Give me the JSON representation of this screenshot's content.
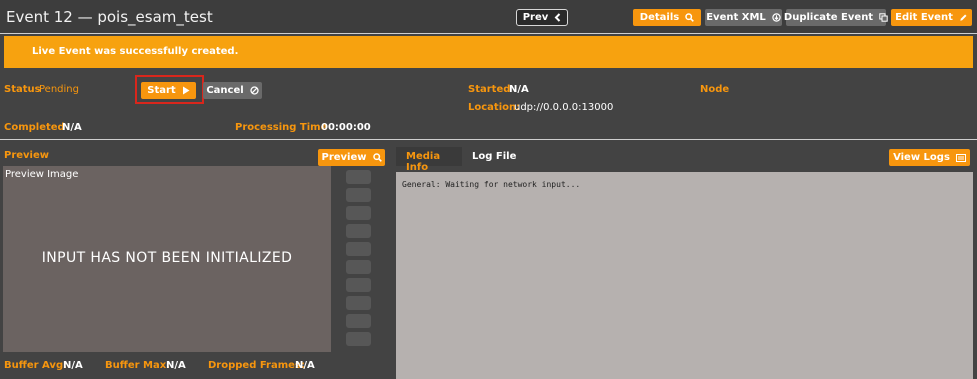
{
  "header": {
    "title": "Event 12 — pois_esam_test",
    "prev_label": "Prev",
    "details_label": "Details",
    "event_xml_label": "Event XML",
    "duplicate_label": "Duplicate Event",
    "edit_label": "Edit Event"
  },
  "banner": {
    "message": "Live Event was successfully created."
  },
  "status": {
    "status_label": "Status",
    "status_value": "Pending",
    "start_label": "Start",
    "cancel_label": "Cancel",
    "started_label": "Started",
    "started_value": "N/A",
    "location_label": "Location:",
    "location_value": "udp://0.0.0.0:13000",
    "node_label": "Node",
    "completed_label": "Completed",
    "completed_value": "N/A",
    "processing_label": "Processing Time",
    "processing_value": "00:00:00"
  },
  "preview": {
    "section_label": "Preview",
    "button_label": "Preview",
    "image_label": "Preview Image",
    "message": "INPUT HAS NOT BEEN INITIALIZED"
  },
  "stats": {
    "buffer_avg_label": "Buffer Avg:",
    "buffer_avg_value": "N/A",
    "buffer_max_label": "Buffer Max:",
    "buffer_max_value": "N/A",
    "dropped_label": "Dropped Frames:",
    "dropped_value": "N/A"
  },
  "info": {
    "tabs": [
      "Media Info",
      "Log File"
    ],
    "view_logs_label": "View Logs",
    "content": "General: Waiting for network input..."
  },
  "colors": {
    "accent": "#f7960e",
    "background": "#434343",
    "highlight": "#d9261c"
  }
}
